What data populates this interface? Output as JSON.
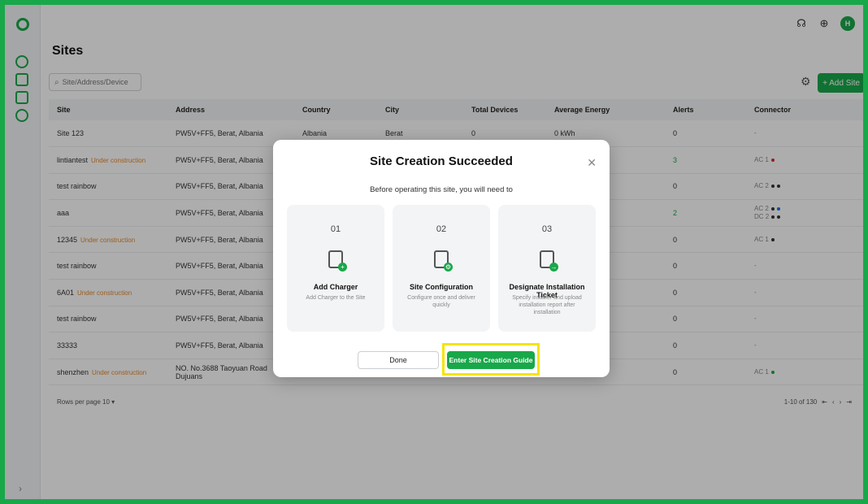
{
  "topbar": {
    "avatar_letter": "H",
    "headset_icon": "headset-icon",
    "globe_icon": "globe-icon"
  },
  "page": {
    "title": "Sites"
  },
  "search": {
    "placeholder": "Site/Address/Device"
  },
  "actions": {
    "add_site_label": "+ Add Site"
  },
  "table": {
    "headers": [
      "Site",
      "Address",
      "Country",
      "City",
      "Total Devices",
      "Average Energy",
      "Alerts",
      "Connector"
    ],
    "rows": [
      {
        "site": "Site 123",
        "tag": "",
        "address": "PW5V+FF5, Berat, Albania",
        "country": "Albania",
        "city": "Berat",
        "devices": "0",
        "energy": "0 kWh",
        "alerts": "0",
        "connector": "-"
      },
      {
        "site": "lintiantest",
        "tag": "Under construction",
        "address": "PW5V+FF5, Berat, Albania",
        "country": "",
        "city": "",
        "devices": "",
        "energy": "",
        "alerts": "3",
        "connector": "AC 1"
      },
      {
        "site": "test rainbow",
        "tag": "",
        "address": "PW5V+FF5, Berat, Albania",
        "country": "",
        "city": "",
        "devices": "",
        "energy": "",
        "alerts": "0",
        "connector": "AC 2"
      },
      {
        "site": "aaa",
        "tag": "",
        "address": "PW5V+FF5, Berat, Albania",
        "country": "",
        "city": "",
        "devices": "",
        "energy": "",
        "alerts": "2",
        "connector": "AC 2",
        "connector2": "DC 2"
      },
      {
        "site": "12345",
        "tag": "Under construction",
        "address": "PW5V+FF5, Berat, Albania",
        "country": "",
        "city": "",
        "devices": "",
        "energy": "",
        "alerts": "0",
        "connector": "AC 1"
      },
      {
        "site": "test rainbow",
        "tag": "",
        "address": "PW5V+FF5, Berat, Albania",
        "country": "",
        "city": "",
        "devices": "",
        "energy": "",
        "alerts": "0",
        "connector": "-"
      },
      {
        "site": "6A01",
        "tag": "Under construction",
        "address": "PW5V+FF5, Berat, Albania",
        "country": "",
        "city": "",
        "devices": "",
        "energy": "",
        "alerts": "0",
        "connector": "-"
      },
      {
        "site": "test rainbow",
        "tag": "",
        "address": "PW5V+FF5, Berat, Albania",
        "country": "",
        "city": "",
        "devices": "",
        "energy": "",
        "alerts": "0",
        "connector": "-"
      },
      {
        "site": "33333",
        "tag": "",
        "address": "PW5V+FF5, Berat, Albania",
        "country": "",
        "city": "",
        "devices": "",
        "energy": "",
        "alerts": "0",
        "connector": "-"
      },
      {
        "site": "shenzhen",
        "tag": "Under construction",
        "address": "NO. No.3688 Taoyuan Road Dujuans",
        "country": "",
        "city": "",
        "devices": "",
        "energy": "",
        "alerts": "0",
        "connector": "AC 1"
      }
    ]
  },
  "pagination": {
    "rows_label": "Rows per page",
    "rows_value": "10",
    "range": "1-10 of 130"
  },
  "modal": {
    "title": "Site Creation Succeeded",
    "subtitle": "Before operating this site, you will need to",
    "steps": [
      {
        "num": "01",
        "title": "Add Charger",
        "desc": "Add Charger to the Site",
        "icon": "charger-add-icon"
      },
      {
        "num": "02",
        "title": "Site Configuration",
        "desc": "Configure once and deliver quickly",
        "icon": "site-config-icon"
      },
      {
        "num": "03",
        "title": "Designate Installation Ticket",
        "desc": "Specify installer and upload installation report after installation",
        "icon": "ticket-icon"
      }
    ],
    "done_label": "Done",
    "guide_label": "Enter Site Creation Guide"
  },
  "colors": {
    "brand": "#18a84a",
    "tag": "#e68a2e",
    "highlight": "#f5e400"
  }
}
